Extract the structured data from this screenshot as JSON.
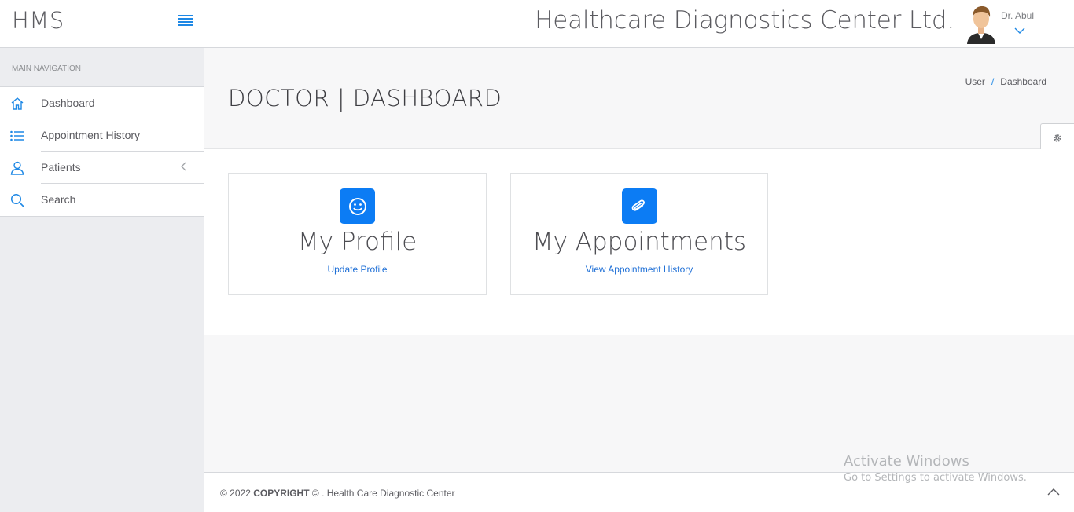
{
  "brand": {
    "name": "HMS"
  },
  "sidebar": {
    "heading": "MAIN NAVIGATION",
    "items": [
      {
        "label": "Dashboard",
        "icon": "home-icon"
      },
      {
        "label": "Appointment History",
        "icon": "list-icon"
      },
      {
        "label": "Patients",
        "icon": "user-icon"
      },
      {
        "label": "Search",
        "icon": "search-icon"
      }
    ]
  },
  "header": {
    "app_title": "Healthcare Diagnostics Center Ltd.",
    "user_name": "Dr. Abul"
  },
  "page": {
    "title": "DOCTOR | DASHBOARD",
    "breadcrumb": [
      "User",
      "Dashboard"
    ]
  },
  "cards": [
    {
      "title": "My Profile",
      "link": "Update Profile",
      "icon": "smile-icon"
    },
    {
      "title": "My Appointments",
      "link": "View Appointment History",
      "icon": "paperclip-icon"
    }
  ],
  "footer": {
    "year": "© 2022",
    "copyright_label": "COPYRIGHT",
    "rest": "© . Health Care Diagnostic Center"
  },
  "watermark": {
    "line1": "Activate Windows",
    "line2": "Go to Settings to activate Windows."
  },
  "colors": {
    "accent": "#1e88e5",
    "badge": "#0c7cf4",
    "link": "#1e6fd6"
  }
}
